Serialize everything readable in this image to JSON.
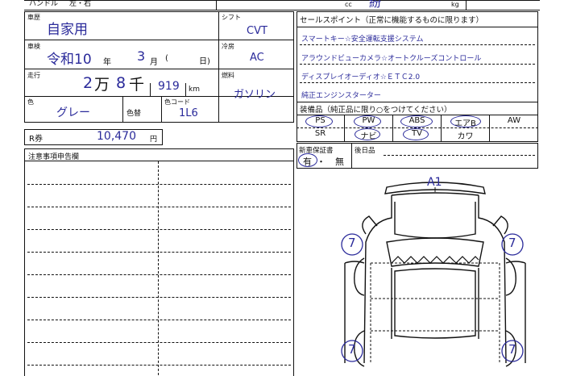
{
  "top": {
    "handle_label": "ハンドル",
    "handle_value": "左・右",
    "cc_label": "cc",
    "cc_value": "紛",
    "kg_label": "kg"
  },
  "history": {
    "label": "車歴",
    "value": "自家用"
  },
  "shift": {
    "label": "シフト",
    "value": "CVT"
  },
  "ac": {
    "label": "冷房",
    "value": "AC"
  },
  "fuel": {
    "label": "燃料",
    "value": "ガソリン"
  },
  "inspection": {
    "label": "車検",
    "era": "令和10",
    "year_unit": "年",
    "month": "3",
    "month_unit": "月",
    "paren_open": "(",
    "day_unit": "日)"
  },
  "mileage": {
    "label": "走行",
    "man_digit": "2",
    "man_unit": "万",
    "sen_digit": "8",
    "sen_unit": "千",
    "rest": "919",
    "unit": "km"
  },
  "color": {
    "label": "色",
    "value": "グレー",
    "change_label": "色替",
    "code_label": "色コード",
    "code_value": "1L6"
  },
  "recycle": {
    "label": "R券",
    "value": "10,470",
    "unit": "円"
  },
  "notes": {
    "label": "注意事項申告欄"
  },
  "sales_points": {
    "label": "セールスポイント（正常に機能するものに限ります）",
    "items": [
      "スマートキー☆安全運転支援システム",
      "アラウンドビューカメラ☆オートクルーズコントロール",
      "ディスプレイオーディオ☆ＥＴＣ2.0",
      "純正エンジンスターター"
    ]
  },
  "equipment": {
    "label": "装備品（純正品に限り○をつけてください）",
    "row1": [
      "PS",
      "PW",
      "ABS",
      "エアB",
      "AW"
    ],
    "row2": [
      "SR",
      "ナビ",
      "TV",
      "カワ",
      ""
    ]
  },
  "warranty": {
    "label": "新車保証書",
    "yes": "有",
    "sep": "・",
    "no": "無",
    "later_label": "後日品"
  },
  "diagram": {
    "marker_top": "A1",
    "marks": [
      "7",
      "7",
      "7",
      "7"
    ]
  }
}
